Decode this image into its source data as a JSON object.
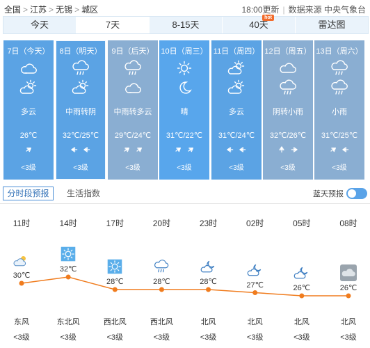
{
  "breadcrumb": {
    "items": [
      "全国",
      "江苏",
      "无锡",
      "城区"
    ],
    "separator": ">"
  },
  "meta": {
    "update": "18:00更新",
    "source": "数据来源 中央气象台"
  },
  "tabs": [
    {
      "label": "今天",
      "active": false
    },
    {
      "label": "7天",
      "active": true
    },
    {
      "label": "8-15天",
      "active": false
    },
    {
      "label": "40天",
      "active": false,
      "badge": "hot"
    },
    {
      "label": "雷达图",
      "active": false
    }
  ],
  "days": [
    {
      "date": "7日（今天）",
      "icons": [
        "cloudy",
        "partly-cloudy-day"
      ],
      "desc": "多云",
      "temp": "26℃",
      "winds": [
        "ne"
      ],
      "level": "<3级",
      "bg": "#5ba3e4"
    },
    {
      "date": "8日（明天）",
      "icons": [
        "rain",
        "partly-cloudy-day"
      ],
      "desc": "中雨转阴",
      "temp": "32℃/25℃",
      "winds": [
        "left",
        "left"
      ],
      "level": "<3级",
      "bg": "#5ba3e4"
    },
    {
      "date": "9日（后天）",
      "icons": [
        "rain",
        "cloudy"
      ],
      "desc": "中雨转多云",
      "temp": "29℃/24℃",
      "winds": [
        "ne",
        "ne"
      ],
      "level": "<3级",
      "bg": "#8aaed2"
    },
    {
      "date": "10日（周三）",
      "icons": [
        "sun",
        "moon"
      ],
      "desc": "晴",
      "temp": "31℃/22℃",
      "winds": [
        "ne",
        "ne"
      ],
      "level": "<3级",
      "bg": "#58a6ec"
    },
    {
      "date": "11日（周四）",
      "icons": [
        "partly-cloudy-day",
        "partly-cloudy-day"
      ],
      "desc": "多云",
      "temp": "31℃/24℃",
      "winds": [
        "left",
        "left"
      ],
      "level": "<3级",
      "bg": "#5ba3e4"
    },
    {
      "date": "12日（周五）",
      "icons": [
        "overcast",
        "rain"
      ],
      "desc": "阴转小雨",
      "temp": "32℃/26℃",
      "winds": [
        "up",
        "right"
      ],
      "level": "<3级",
      "bg": "#8aaed2"
    },
    {
      "date": "13日（周六）",
      "icons": [
        "rain",
        "rain"
      ],
      "desc": "小雨",
      "temp": "31℃/25℃",
      "winds": [
        "ne",
        "left"
      ],
      "level": "<3级",
      "bg": "#8aaed2"
    }
  ],
  "subtabs": {
    "hourly": "分时段预报",
    "life": "生活指数"
  },
  "bluesky": {
    "label": "蓝天预报",
    "enabled": true
  },
  "hourly": [
    {
      "time": "11时",
      "icon": "partly-cloudy-day",
      "temp": 30,
      "temp_label": "30℃",
      "wind": "东风",
      "level": "<3级"
    },
    {
      "time": "14时",
      "icon": "sun",
      "temp": 32,
      "temp_label": "32℃",
      "wind": "东北风",
      "level": "<3级"
    },
    {
      "time": "17时",
      "icon": "sun",
      "temp": 28,
      "temp_label": "28℃",
      "wind": "西北风",
      "level": "<3级"
    },
    {
      "time": "20时",
      "icon": "rain",
      "temp": 28,
      "temp_label": "28℃",
      "wind": "西北风",
      "level": "<3级"
    },
    {
      "time": "23时",
      "icon": "partly-cloudy-night",
      "temp": 28,
      "temp_label": "28℃",
      "wind": "北风",
      "level": "<3级"
    },
    {
      "time": "02时",
      "icon": "partly-cloudy-night",
      "temp": 27,
      "temp_label": "27℃",
      "wind": "北风",
      "level": "<3级"
    },
    {
      "time": "05时",
      "icon": "partly-cloudy-night",
      "temp": 26,
      "temp_label": "26℃",
      "wind": "北风",
      "level": "<3级"
    },
    {
      "time": "08时",
      "icon": "overcast-tile",
      "temp": 26,
      "temp_label": "26℃",
      "wind": "北风",
      "level": "<3级"
    }
  ],
  "colors": {
    "line": "#f07c1e",
    "accent": "#4a8ed6"
  }
}
